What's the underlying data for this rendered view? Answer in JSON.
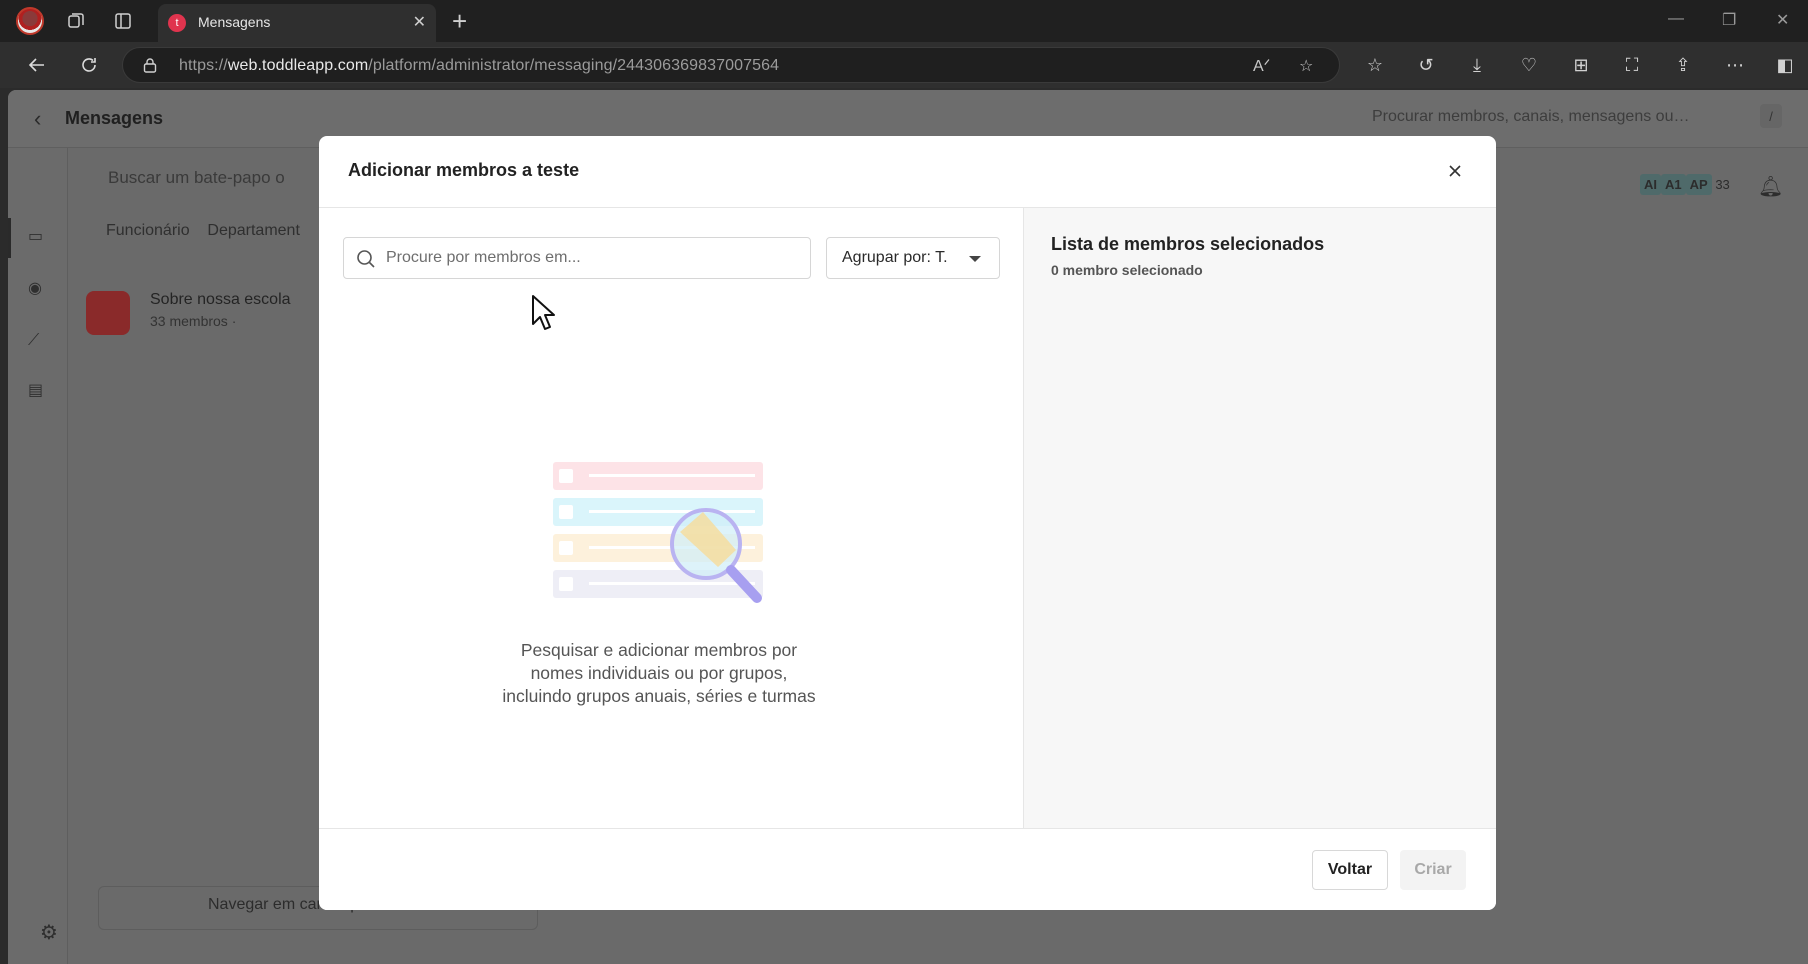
{
  "browser": {
    "tab_title": "Mensagens",
    "url_host": "web.toddleapp.com",
    "url_prefix": "https://",
    "url_path": "/platform/administrator/messaging/244306369837007564"
  },
  "app": {
    "page_title": "Mensagens",
    "global_search_placeholder": "Procurar membros, canais, mensagens ou…",
    "shortcut_key": "/",
    "chat_search_placeholder": "Buscar um bate-papo o",
    "filters": [
      "Funcionário",
      "Departament"
    ],
    "chat_item": {
      "name": "Sobre nossa escola",
      "subtitle": "33 membros ·"
    },
    "browse_public_channels": "Navegar em canais públicos",
    "avatars": [
      "AI",
      "A1",
      "AP"
    ],
    "member_count": "33"
  },
  "modal": {
    "title": "Adicionar membros a teste",
    "search_placeholder": "Procure por membros em...",
    "group_by_label": "Agrupar por: T.",
    "empty_message": "Pesquisar e adicionar membros por nomes individuais ou por grupos, incluindo grupos anuais, séries e turmas",
    "selected_title": "Lista de membros selecionados",
    "selected_count": "0 membro selecionado",
    "back_label": "Voltar",
    "create_label": "Criar"
  },
  "colors": {
    "accent": "#e0344e",
    "overlay": "#6a6a6a",
    "modal_bg": "#ffffff",
    "right_pane_bg": "#f7f7f7"
  }
}
